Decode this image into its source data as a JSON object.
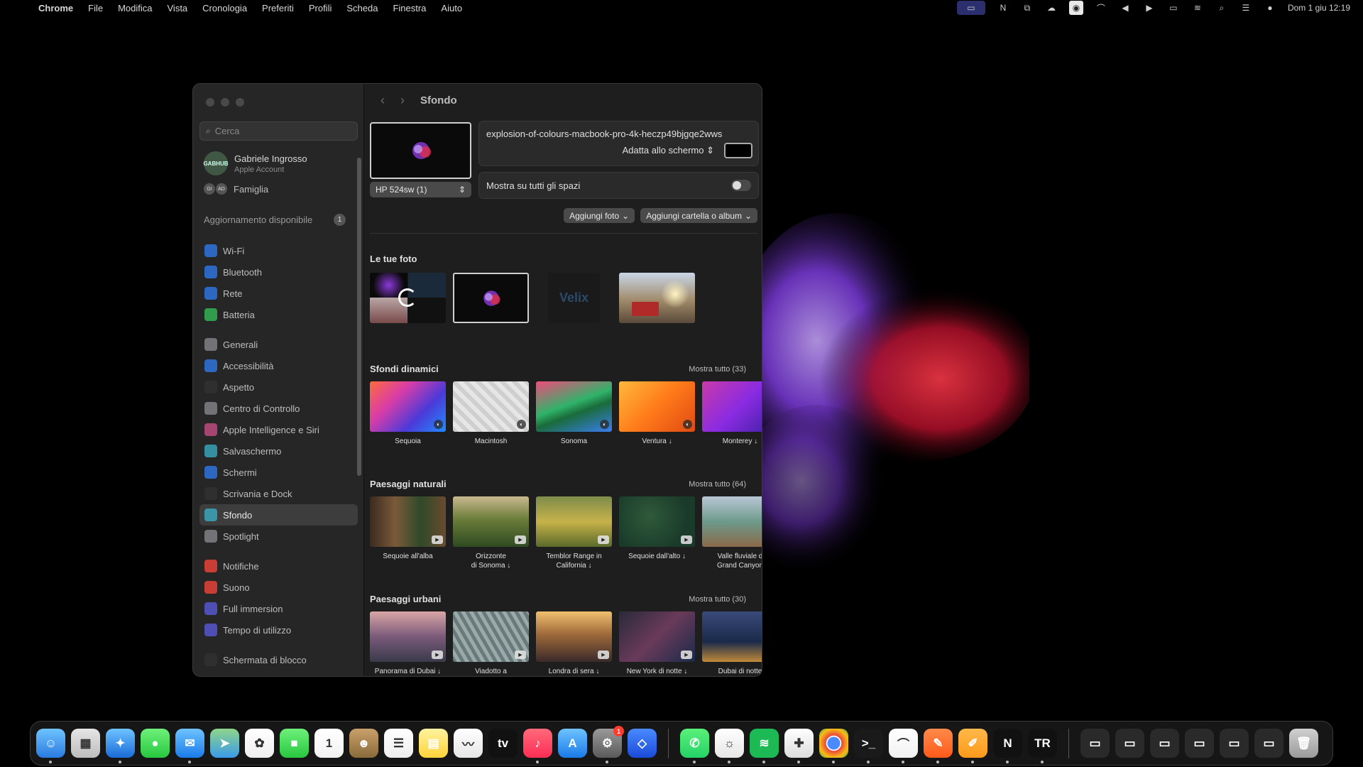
{
  "menubar": {
    "app": "Chrome",
    "items": [
      "File",
      "Modifica",
      "Vista",
      "Cronologia",
      "Preferiti",
      "Profili",
      "Scheda",
      "Finestra",
      "Aiuto"
    ],
    "clock": "Dom 1 giu  12:19"
  },
  "sidebar": {
    "search_placeholder": "Cerca",
    "account_name": "Gabriele Ingrosso",
    "account_sub": "Apple Account",
    "avatar_text": "GABHUB",
    "family_label": "Famiglia",
    "family_avatars": [
      "GI",
      "AD"
    ],
    "update_label": "Aggiornamento disponibile",
    "update_count": "1",
    "items": [
      {
        "label": "Wi-Fi",
        "icon": "wifi-icon",
        "color": "#2f7ef7"
      },
      {
        "label": "Bluetooth",
        "icon": "bluetooth-icon",
        "color": "#2f7ef7"
      },
      {
        "label": "Rete",
        "icon": "globe-icon",
        "color": "#2f7ef7"
      },
      {
        "label": "Batteria",
        "icon": "battery-icon",
        "color": "#33c659"
      },
      {
        "label": "Generali",
        "icon": "gear-icon",
        "color": "#8e8e93"
      },
      {
        "label": "Accessibilità",
        "icon": "accessibility-icon",
        "color": "#2f7ef7"
      },
      {
        "label": "Aspetto",
        "icon": "appearance-icon",
        "color": "#333333"
      },
      {
        "label": "Centro di Controllo",
        "icon": "control-center-icon",
        "color": "#8e8e93"
      },
      {
        "label": "Apple Intelligence e Siri",
        "icon": "siri-icon",
        "color": "#d0508a"
      },
      {
        "label": "Salvaschermo",
        "icon": "screensaver-icon",
        "color": "#3ab3c9"
      },
      {
        "label": "Schermi",
        "icon": "display-icon",
        "color": "#2f7ef7"
      },
      {
        "label": "Scrivania e Dock",
        "icon": "dock-icon",
        "color": "#333333"
      },
      {
        "label": "Sfondo",
        "icon": "wallpaper-icon",
        "color": "#3ab3c9"
      },
      {
        "label": "Spotlight",
        "icon": "spotlight-icon",
        "color": "#8e8e93"
      },
      {
        "label": "Notifiche",
        "icon": "bell-icon",
        "color": "#ff453a"
      },
      {
        "label": "Suono",
        "icon": "speaker-icon",
        "color": "#ff453a"
      },
      {
        "label": "Full immersion",
        "icon": "moon-icon",
        "color": "#5e5ce6"
      },
      {
        "label": "Tempo di utilizzo",
        "icon": "hourglass-icon",
        "color": "#5e5ce6"
      },
      {
        "label": "Schermata di blocco",
        "icon": "lock-icon",
        "color": "#333333"
      }
    ],
    "selected": "Sfondo"
  },
  "content": {
    "title": "Sfondo",
    "display_name": "HP 524sw (1)",
    "file_name": "explosion-of-colours-macbook-pro-4k-heczp49bjgqe2wws",
    "fit_mode": "Adatta allo schermo",
    "spaces_label": "Mostra su tutti gli spazi",
    "add_photo": "Aggiungi foto",
    "add_folder": "Aggiungi cartella o album",
    "your_photos_title": "Le tue foto",
    "your_photos_logo": "Velix"
  },
  "sections": [
    {
      "title": "Sfondi dinamici",
      "more": "Mostra tutto (33)",
      "tiles": [
        {
          "caption": "Sequoia",
          "bg": "linear-gradient(135deg,#ff6a3d,#d83da8,#4b3ad8,#1f8cff)"
        },
        {
          "caption": "Macintosh",
          "bg": "repeating-linear-gradient(45deg,#cfcfcf 0 6px,#e6e6e6 6px 12px)"
        },
        {
          "caption": "Sonoma",
          "bg": "linear-gradient(160deg,#f04b7a,#2fb36a 45%,#1a6b3a 60%,#3a7ef0)"
        },
        {
          "caption": "Ventura ↓",
          "bg": "linear-gradient(135deg,#ffb83d,#ff7a1a,#e04a12)"
        },
        {
          "caption": "Monterey ↓",
          "bg": "linear-gradient(135deg,#c93aa8,#8a2be2,#3a1f9e)"
        }
      ]
    },
    {
      "title": "Paesaggi naturali",
      "more": "Mostra tutto (64)",
      "tiles": [
        {
          "caption": "Sequoie all'alba",
          "bg": "linear-gradient(90deg,#3b2a1e,#7a5a3a,#2f4a2a,#6a4a2e)"
        },
        {
          "caption": "Orizzonte\ndi Sonoma ↓",
          "bg": "linear-gradient(180deg,#c9b98f,#6b7d3a 45%,#2f4a22)"
        },
        {
          "caption": "Temblor Range in\nCalifornia ↓",
          "bg": "linear-gradient(180deg,#7d8c4a,#c7b24a 50%,#5a6a2a)"
        },
        {
          "caption": "Sequoie dall'alto ↓",
          "bg": "radial-gradient(circle at 40% 40%,#2f5a3a,#1a3a2a 70%)"
        },
        {
          "caption": "Valle fluviale d\nGrand Canyon",
          "bg": "linear-gradient(180deg,#b9c7d6,#6d9a8a 50%,#8a6a4a)"
        }
      ]
    },
    {
      "title": "Paesaggi urbani",
      "more": "Mostra tutto (30)",
      "tiles": [
        {
          "caption": "Panorama di Dubai ↓",
          "bg": "linear-gradient(180deg,#d9a6a6,#7a5a7a 50%,#3a3a4a)"
        },
        {
          "caption": "Viadotto a\nLos Angeles ↓",
          "bg": "repeating-linear-gradient(60deg,#6a7a7a 0 5px,#9aaaaa 5px 10px)"
        },
        {
          "caption": "Londra di sera ↓",
          "bg": "linear-gradient(180deg,#f0c070,#a06a3a 45%,#3a2a2a)"
        },
        {
          "caption": "New York di notte ↓",
          "bg": "linear-gradient(135deg,#2a2a3a,#6a3a5a,#1a2a4a)"
        },
        {
          "caption": "Dubai di notte",
          "bg": "linear-gradient(180deg,#3a4a7a,#1a2a4a 60%,#c08a3a)"
        }
      ]
    }
  ],
  "dock": [
    {
      "name": "finder",
      "bg": "linear-gradient(#6ec3ff,#2a7be0)",
      "glyph": "☺",
      "running": true
    },
    {
      "name": "launchpad",
      "bg": "linear-gradient(#e6e6e6,#bdbdbd)",
      "glyph": "▦",
      "running": false
    },
    {
      "name": "safari",
      "bg": "linear-gradient(#6ec3ff,#1a6bd8)",
      "glyph": "✦",
      "running": true
    },
    {
      "name": "messages",
      "bg": "linear-gradient(#6ef07a,#28c840)",
      "glyph": "●",
      "running": false
    },
    {
      "name": "mail",
      "bg": "linear-gradient(#6ec3ff,#1a7be8)",
      "glyph": "✉",
      "running": true
    },
    {
      "name": "maps",
      "bg": "linear-gradient(#8fd68a,#3a9ae8)",
      "glyph": "➤",
      "running": false
    },
    {
      "name": "photos",
      "bg": "linear-gradient(#ffffff,#eeeeee)",
      "glyph": "✿",
      "running": false
    },
    {
      "name": "facetime",
      "bg": "linear-gradient(#6ef07a,#28c840)",
      "glyph": "■",
      "running": false
    },
    {
      "name": "calendar",
      "bg": "linear-gradient(#ffffff,#f2f2f2)",
      "glyph": "1",
      "running": false
    },
    {
      "name": "contacts",
      "bg": "linear-gradient(#c9a06a,#8a6a3a)",
      "glyph": "☻",
      "running": false
    },
    {
      "name": "reminders",
      "bg": "linear-gradient(#ffffff,#eeeeee)",
      "glyph": "☰",
      "running": false
    },
    {
      "name": "notes",
      "bg": "linear-gradient(#fff3a0,#ffd43a)",
      "glyph": "▤",
      "running": false
    },
    {
      "name": "freeform",
      "bg": "linear-gradient(#ffffff,#e6e6e6)",
      "glyph": "〰",
      "running": false
    },
    {
      "name": "apple-tv",
      "bg": "#111111",
      "glyph": "tv",
      "running": false
    },
    {
      "name": "music",
      "bg": "linear-gradient(#ff6a7a,#ff2d55)",
      "glyph": "♪",
      "running": true
    },
    {
      "name": "app-store",
      "bg": "linear-gradient(#6ec3ff,#1a7be8)",
      "glyph": "A",
      "running": false
    },
    {
      "name": "system-settings",
      "bg": "linear-gradient(#9a9a9a,#5a5a5a)",
      "glyph": "⚙",
      "running": true,
      "badge": "1"
    },
    {
      "name": "screen-sharing",
      "bg": "linear-gradient(#4a8aff,#1a4bd8)",
      "glyph": "◇",
      "running": false
    },
    {
      "sep": true
    },
    {
      "name": "whatsapp",
      "bg": "linear-gradient(#5af07a,#25d366)",
      "glyph": "✆",
      "running": true
    },
    {
      "name": "app-lightbulb",
      "bg": "linear-gradient(#ffffff,#e6e6e6)",
      "glyph": "☼",
      "running": true
    },
    {
      "name": "spotify",
      "bg": "#1db954",
      "glyph": "≋",
      "running": true
    },
    {
      "name": "app-tool",
      "bg": "linear-gradient(#ffffff,#dddddd)",
      "glyph": "✚",
      "running": true
    },
    {
      "name": "chrome",
      "bg": "radial-gradient(#4a8aff 30%,#ffffff 32%,#ffffff 36%,#e8453c 38%,#f9bc15 70%,#34a853)",
      "glyph": "",
      "running": true
    },
    {
      "name": "terminal",
      "bg": "#1a1a1a",
      "glyph": ">_",
      "running": true
    },
    {
      "name": "arc",
      "bg": "linear-gradient(#ffffff,#f2f2f2)",
      "glyph": "⌒",
      "running": true
    },
    {
      "name": "app-pencil",
      "bg": "linear-gradient(#ff8a4a,#ff5a1a)",
      "glyph": "✎",
      "running": true
    },
    {
      "name": "pages",
      "bg": "linear-gradient(#ffb84a,#ff9a1a)",
      "glyph": "✐",
      "running": true
    },
    {
      "name": "notion-n",
      "bg": "#111111",
      "glyph": "N",
      "running": true
    },
    {
      "name": "app-tr",
      "bg": "#111111",
      "glyph": "TR",
      "running": true
    },
    {
      "sep": true
    },
    {
      "name": "minimized-window-1",
      "bg": "#2a2a2a",
      "glyph": "▭",
      "running": false
    },
    {
      "name": "minimized-window-2",
      "bg": "#2a2a2a",
      "glyph": "▭",
      "running": false
    },
    {
      "name": "minimized-window-3",
      "bg": "#2a2a2a",
      "glyph": "▭",
      "running": false
    },
    {
      "name": "minimized-window-4",
      "bg": "#2a2a2a",
      "glyph": "▭",
      "running": false
    },
    {
      "name": "minimized-window-5",
      "bg": "#2a2a2a",
      "glyph": "▭",
      "running": false
    },
    {
      "name": "minimized-window-6",
      "bg": "#2a2a2a",
      "glyph": "▭",
      "running": false
    },
    {
      "name": "trash",
      "bg": "linear-gradient(#d0d0d0,#9a9a9a)",
      "glyph": "🗑",
      "running": false
    }
  ]
}
